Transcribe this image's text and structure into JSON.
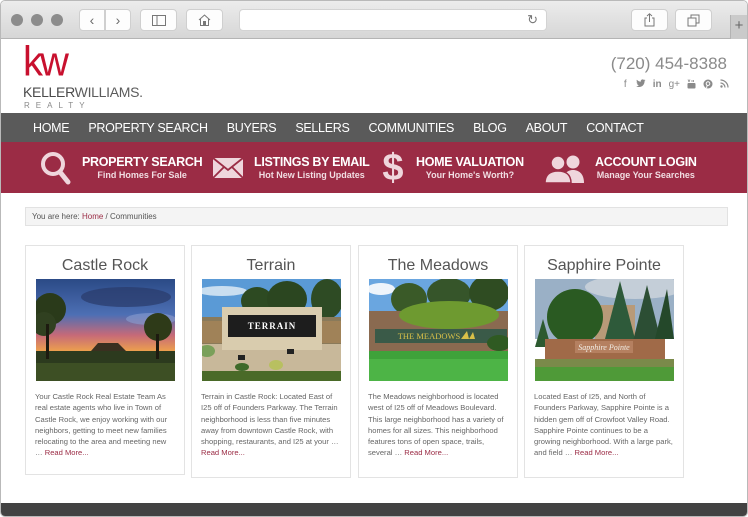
{
  "browser": {
    "nav_back_icon": "chevron-left",
    "nav_forward_icon": "chevron-right",
    "sidebar_icon": "sidebar",
    "home_icon": "home",
    "reload_icon": "reload",
    "share_icon": "share",
    "tabs_icon": "tabs",
    "new_tab_label": "+",
    "address_value": ""
  },
  "header": {
    "logo_mark": "kw",
    "logo_name_bold": "KELLER",
    "logo_name_light": "WILLIAMS.",
    "logo_sub": "REALTY",
    "phone": "(720) 454-8388",
    "socials": [
      {
        "name": "facebook",
        "glyph": "f"
      },
      {
        "name": "twitter",
        "glyph": "🐦︎"
      },
      {
        "name": "linkedin",
        "glyph": "in"
      },
      {
        "name": "google-plus",
        "glyph": "g+"
      },
      {
        "name": "youtube",
        "glyph": "▣"
      },
      {
        "name": "pinterest",
        "glyph": "℗"
      },
      {
        "name": "rss",
        "glyph": "⌁"
      }
    ]
  },
  "nav": {
    "items": [
      "HOME",
      "PROPERTY SEARCH",
      "BUYERS",
      "SELLERS",
      "COMMUNITIES",
      "BLOG",
      "ABOUT",
      "CONTACT"
    ]
  },
  "quick_links": [
    {
      "icon": "search",
      "title": "PROPERTY SEARCH",
      "subtitle": "Find Homes For Sale"
    },
    {
      "icon": "envelope",
      "title": "LISTINGS BY EMAIL",
      "subtitle": "Hot New Listing Updates"
    },
    {
      "icon": "dollar",
      "title": "HOME VALUATION",
      "subtitle": "Your Home's Worth?"
    },
    {
      "icon": "users",
      "title": "ACCOUNT LOGIN",
      "subtitle": "Manage Your Searches"
    }
  ],
  "breadcrumb": {
    "prefix": "You are here: ",
    "home": "Home",
    "separator": " / ",
    "current": "Communities"
  },
  "communities": [
    {
      "title": "Castle Rock",
      "image": "sunset over Castle Rock butte with trees",
      "excerpt": "Your Castle Rock Real Estate Team As real estate agents who live in Town of Castle Rock, we enjoy working with our neighbors, getting to meet new families relocating to the area and meeting new … ",
      "read_more": "Read More..."
    },
    {
      "title": "Terrain",
      "image": "Terrain neighborhood stone entrance sign",
      "excerpt": "Terrain in Castle Rock: Located East of I25 off of Founders Parkway.  The Terrain neighborhood is less than five minutes away from downtown Castle Rock, with shopping, restaurants, and I25 at your … ",
      "read_more": "Read More..."
    },
    {
      "title": "The Meadows",
      "image": "The Meadows entrance sign with green lawn",
      "excerpt": "The Meadows neighborhood is located west of I25 off of Meadows Boulevard. This large neighborhood has a variety of homes for all sizes. This neighborhood features tons of open space, trails, several … ",
      "read_more": "Read More..."
    },
    {
      "title": "Sapphire Pointe",
      "image": "Sapphire Pointe brick entrance sign with evergreens",
      "excerpt": "Located East of I25, and North of Founders Parkway, Sapphire Pointe is a hidden gem off of Crowfoot Valley Road.  Sapphire Pointe continues to be a growing neighborhood.  With a large park, and field … ",
      "read_more": "Read More..."
    }
  ],
  "colors": {
    "brand_red": "#c8102e",
    "quick_bar": "#9b2c45",
    "nav_bg": "#5a5a5a",
    "footer_bg": "#424242",
    "link": "#9b2c45"
  }
}
